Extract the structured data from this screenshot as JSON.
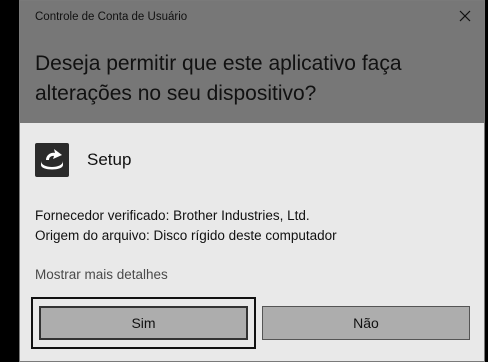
{
  "dialog": {
    "caption": "Controle de Conta de Usuário",
    "close_icon": "close-icon",
    "question": "Deseja permitir que este aplicativo faça alterações no seu dispositivo?",
    "app": {
      "icon": "setup-app-icon",
      "name": "Setup"
    },
    "publisher_line": "Fornecedor verificado: Brother Industries, Ltd.",
    "origin_line": "Origem do arquivo: Disco rígido deste computador",
    "more_details": "Mostrar mais detalhes",
    "buttons": {
      "yes": "Sim",
      "no": "Não"
    }
  },
  "colors": {
    "header": "#777777",
    "body": "#e9e9e9",
    "button": "#adadad",
    "background": "#000000"
  }
}
